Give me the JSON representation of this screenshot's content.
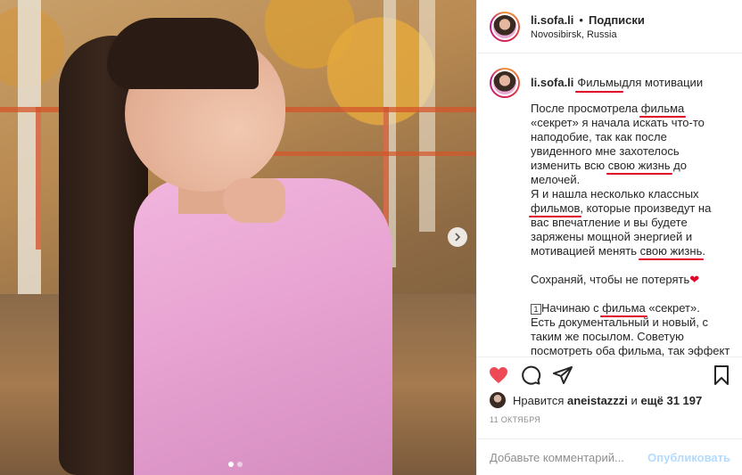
{
  "header": {
    "username": "li.sofa.li",
    "separator": "•",
    "follow_label": "Подписки",
    "location": "Novosibirsk, Russia"
  },
  "caption": {
    "username": "li.sofa.li",
    "title_word_1": "Фильмы",
    "title_rest": " для мотивации",
    "p1_a": "После просмотрела ",
    "p1_u1": "фильма",
    "p1_b": "\n«секрет» я начала искать что-то\nнаподобие, так как после\nувиденного мне захотелось\nизменить всю ",
    "p1_u2": "свою жизнь",
    "p1_c": " до\nмелочей.\nЯ и нашла несколько классных\n",
    "p1_u3": "фильмов",
    "p1_d": ", которые произведут на\nвас впечатление и вы будете\nзаряжены мощной энергией и\nмотивацией менять ",
    "p1_u4": "свою жизнь",
    "p1_e": ".\n\nСохраняй, чтобы не потерять",
    "heart": "❤",
    "p2_num": "1",
    "p2_a": "Начинаю с ",
    "p2_u1": "фильма",
    "p2_b": " «секрет».\nЕсть документальный и новый, с\nтаким же посылом. Советую\nпосмотреть оба фильма, так эффект"
  },
  "likes": {
    "prefix": "Нравится ",
    "user": "aneistazzzi",
    "middle": " и ",
    "count": "ещё 31 197"
  },
  "date": "11 ОКТЯБРЯ",
  "comment": {
    "placeholder": "Добавьте комментарий...",
    "publish_label": "Опубликовать"
  },
  "carousel": {
    "slides": 2,
    "active": 1
  },
  "colors": {
    "like_red": "#ed4956",
    "publish_blue": "#b3dbff",
    "underline_red": "#e0002a"
  },
  "icons": [
    "heart-icon",
    "comment-icon",
    "share-icon",
    "bookmark-icon",
    "chevron-right-icon"
  ]
}
